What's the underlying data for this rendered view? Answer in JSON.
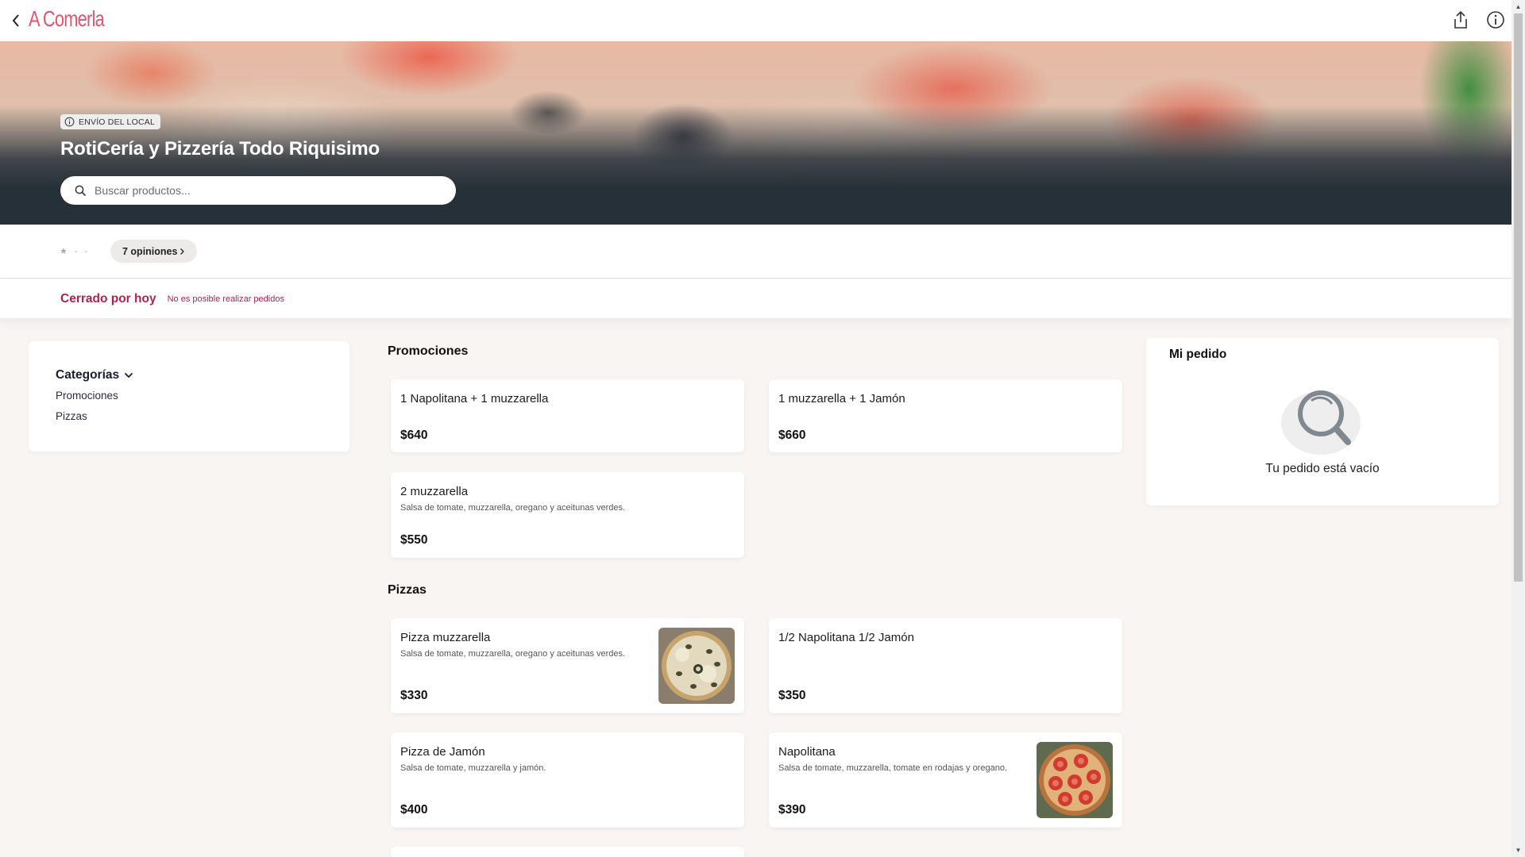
{
  "topbar": {
    "brand": "A Comerla",
    "back_icon": "chevron-left-icon",
    "share_icon": "share-icon",
    "info_icon": "info-icon"
  },
  "hero": {
    "badge_icon": "info-circle-icon",
    "badge_label": "ENVÍO DEL LOCAL",
    "store_name": "RotiCería y Pizzería Todo Riquisimo",
    "search_placeholder": "Buscar productos..."
  },
  "reviews": {
    "stars_text": "★ - -",
    "opinions_label": "7 opiniones"
  },
  "status": {
    "title": "Cerrado por hoy",
    "subtitle": "No es posible realizar pedidos"
  },
  "categories": {
    "title": "Categorías",
    "items": [
      {
        "label": "Promociones"
      },
      {
        "label": "Pizzas"
      }
    ]
  },
  "sections": {
    "promociones": {
      "title": "Promociones",
      "products": [
        {
          "name": "1 Napolitana + 1 muzzarella",
          "desc": "",
          "price": "$640"
        },
        {
          "name": "1 muzzarella + 1 Jamón",
          "desc": "",
          "price": "$660"
        },
        {
          "name": "2 muzzarella",
          "desc": "Salsa de tomate, muzzarella, oregano y aceitunas verdes.",
          "price": "$550"
        }
      ]
    },
    "pizzas": {
      "title": "Pizzas",
      "products": [
        {
          "name": "Pizza muzzarella",
          "desc": "Salsa de tomate, muzzarella, oregano y aceitunas verdes.",
          "price": "$330"
        },
        {
          "name": "1/2 Napolitana 1/2 Jamón",
          "desc": "",
          "price": "$350"
        },
        {
          "name": "Pizza de Jamón",
          "desc": "Salsa de tomate, muzzarella y jamón.",
          "price": "$400"
        },
        {
          "name": "Napolitana",
          "desc": "Salsa de tomate, muzzarella, tomate en rodajas y oregano.",
          "price": "$390"
        }
      ]
    }
  },
  "order": {
    "title": "Mi pedido",
    "empty_text": "Tu pedido está vacío",
    "empty_icon": "search-icon"
  },
  "colors": {
    "brand": "#e0566f",
    "closed": "#b0224e",
    "hero_dark": "#263038"
  }
}
